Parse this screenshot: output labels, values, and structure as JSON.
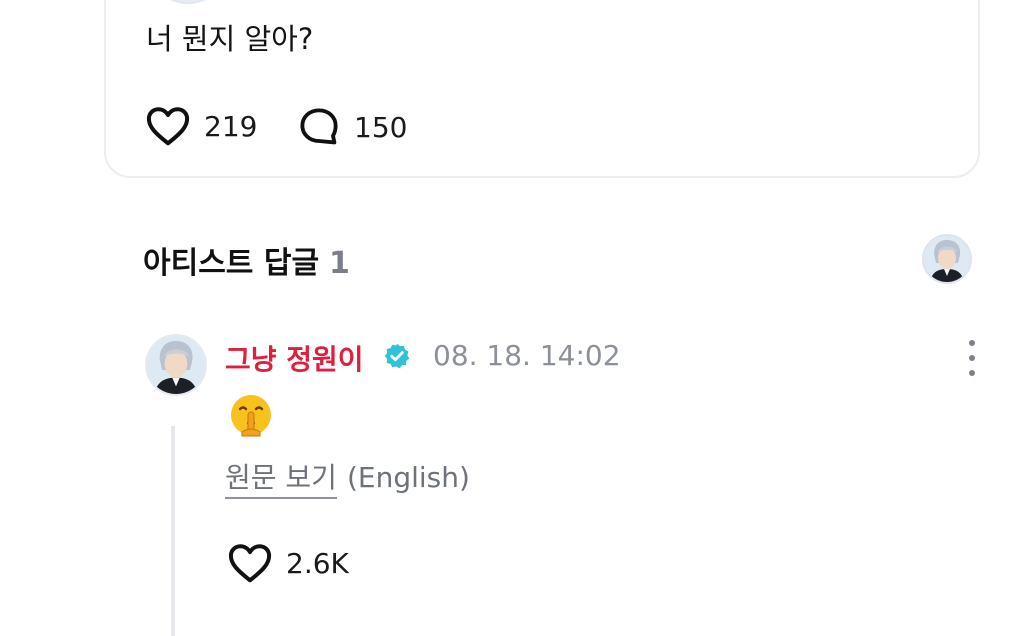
{
  "post": {
    "text": "너 뭔지 알아?",
    "likes": "219",
    "comments": "150"
  },
  "section": {
    "title": "아티스트 답글",
    "count": "1"
  },
  "reply": {
    "author": "그냥 정원이",
    "time": "08. 18. 14:02",
    "emoji": "🤫",
    "translate_link": "원문 보기",
    "translate_lang": "(English)",
    "likes": "2.6K"
  },
  "colors": {
    "author_name": "#e01f3d",
    "verified_badge": "#2ec4d6",
    "muted_text": "#8c9099"
  },
  "icons": [
    "heart-icon",
    "comment-bubble-icon",
    "verified-badge-icon",
    "more-vertical-icon",
    "shushing-face-emoji"
  ]
}
